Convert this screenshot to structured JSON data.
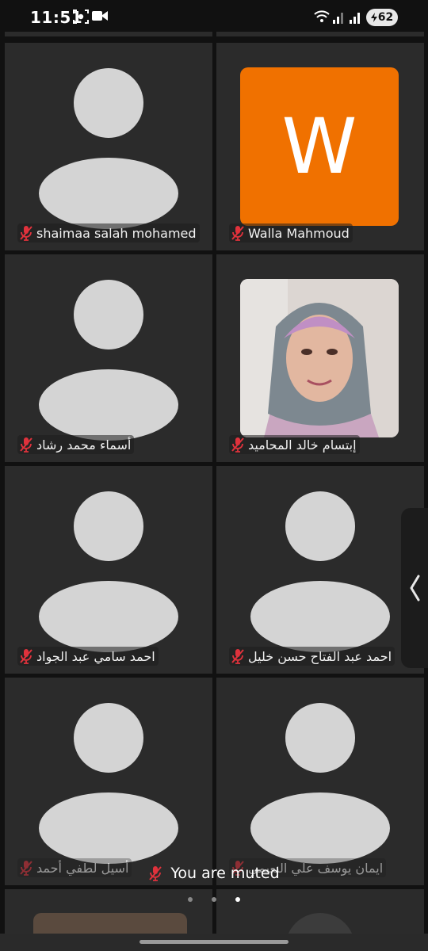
{
  "status_bar": {
    "time": "11:51",
    "battery": "62",
    "icons": [
      "screen-record-icon",
      "video-camera-icon",
      "wifi-icon",
      "signal-icon",
      "signal-icon",
      "battery-icon"
    ]
  },
  "participants": [
    {
      "name": "shaimaa salah mohamed",
      "avatar": "placeholder",
      "muted": true
    },
    {
      "name": "Walla Mahmoud",
      "avatar": "initial",
      "initial": "W",
      "avatar_color": "#f07100",
      "muted": true
    },
    {
      "name": "أسماء محمد رشاد",
      "avatar": "placeholder",
      "muted": true
    },
    {
      "name": "إبتسام خالد المحاميد",
      "avatar": "photo",
      "muted": true
    },
    {
      "name": "احمد سامي عبد الجواد",
      "avatar": "placeholder",
      "muted": true
    },
    {
      "name": "احمد عبد الفتاح حسن خليل",
      "avatar": "placeholder",
      "muted": true
    },
    {
      "name": "أسيل لطفي أحمد",
      "avatar": "placeholder",
      "muted": true
    },
    {
      "name": "ايمان يوسف علي النعيمي",
      "avatar": "placeholder",
      "muted": true
    }
  ],
  "toast": {
    "text": "You are muted"
  },
  "pagination": {
    "pages": 3,
    "active": 3
  },
  "colors": {
    "tile": "#2b2b2b",
    "background": "#111111",
    "muted_icon": "#e0323c"
  }
}
